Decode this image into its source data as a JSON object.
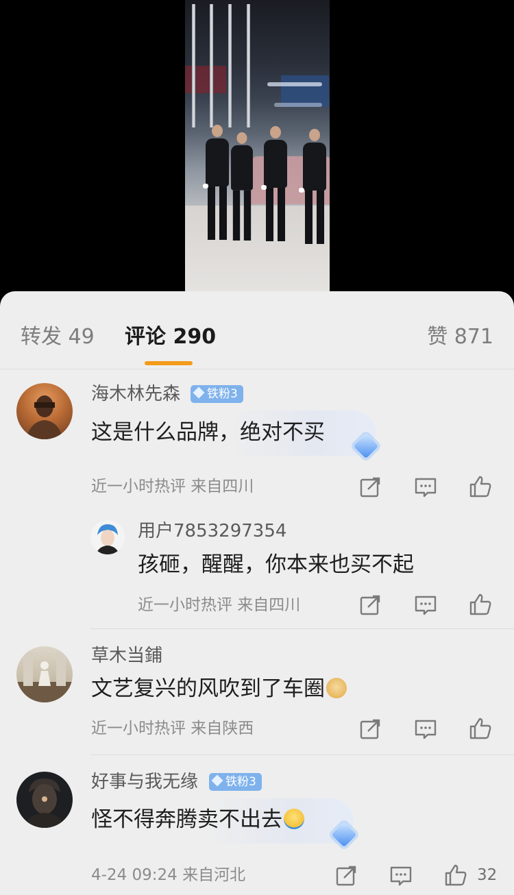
{
  "tabs": {
    "repost": "转发 49",
    "comments": "评论 290",
    "likes": "赞 871"
  },
  "colors": {
    "accent_underline": "#f39b1a",
    "badge_blue": "#7fb2ec",
    "sheet_bg": "#eeeeee"
  },
  "comments": [
    {
      "username": "海木林先森",
      "badge": "铁粉3",
      "text": "这是什么品牌，绝对不买",
      "meta": "近一小时热评  来自四川",
      "reply": {
        "username": "用户7853297354",
        "text": "孩砸，醒醒，你本来也买不起",
        "meta": "近一小时热评  来自四川"
      }
    },
    {
      "username": "草木当鋪",
      "text": "文艺复兴的风吹到了车圈",
      "emoji": "doge-emoji",
      "meta": "近一小时热评  来自陕西"
    },
    {
      "username": "好事与我无缘",
      "badge": "铁粉3",
      "text": "怪不得奔腾卖不出去",
      "emoji": "shrug-emoji",
      "meta": "4-24 09:24  来自河北",
      "like_count": "32"
    }
  ],
  "icons": [
    "share-icon",
    "comment-icon",
    "thumbs-up-icon",
    "diamond-icon",
    "gem-icon"
  ]
}
